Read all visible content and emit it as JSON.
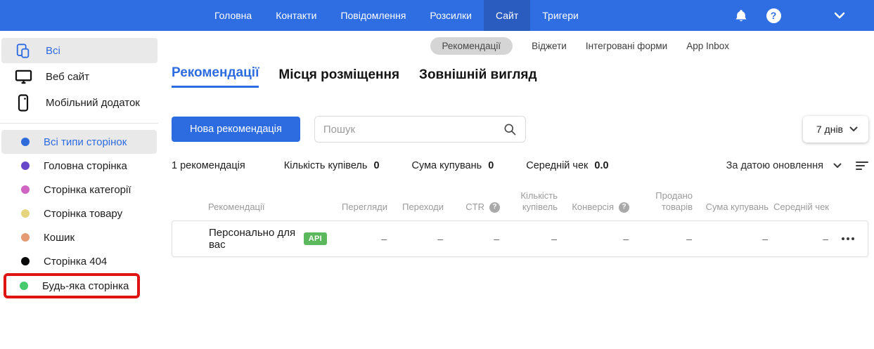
{
  "topnav": {
    "items": [
      {
        "label": "Головна",
        "active": false
      },
      {
        "label": "Контакти",
        "active": false
      },
      {
        "label": "Повідомлення",
        "active": false
      },
      {
        "label": "Розсилки",
        "active": false
      },
      {
        "label": "Сайт",
        "active": true
      },
      {
        "label": "Тригери",
        "active": false
      }
    ],
    "icons": [
      "bell-icon",
      "help-icon",
      "chevron-down-icon"
    ]
  },
  "subnav": {
    "items": [
      {
        "label": "Рекомендації",
        "active": true
      },
      {
        "label": "Віджети",
        "active": false
      },
      {
        "label": "Інтегровані форми",
        "active": false
      },
      {
        "label": "App Inbox",
        "active": false
      }
    ]
  },
  "sidebar": {
    "sources": [
      {
        "label": "Всі",
        "icon": "devices-icon",
        "active": true
      },
      {
        "label": "Веб сайт",
        "icon": "desktop-icon",
        "active": false
      },
      {
        "label": "Мобільний додаток",
        "icon": "mobile-icon",
        "active": false
      }
    ],
    "page_types": [
      {
        "label": "Всі типи сторінок",
        "dot": "#2e6bd9",
        "active": true,
        "highlighted": false
      },
      {
        "label": "Головна сторінка",
        "dot": "#6847c8",
        "active": false,
        "highlighted": false
      },
      {
        "label": "Сторінка категорії",
        "dot": "#cf64c3",
        "active": false,
        "highlighted": false
      },
      {
        "label": "Сторінка товару",
        "dot": "#e6d47e",
        "active": false,
        "highlighted": false
      },
      {
        "label": "Кошик",
        "dot": "#e49a72",
        "active": false,
        "highlighted": false
      },
      {
        "label": "Сторінка 404",
        "dot": "#0a0a0a",
        "active": false,
        "highlighted": false
      },
      {
        "label": "Будь-яка сторінка",
        "dot": "#47c96e",
        "active": false,
        "highlighted": true
      }
    ]
  },
  "tabs": [
    {
      "label": "Рекомендації",
      "active": true
    },
    {
      "label": "Місця розміщення",
      "active": false
    },
    {
      "label": "Зовнішній вигляд",
      "active": false
    }
  ],
  "toolbar": {
    "new_button": "Нова рекомендація",
    "search_placeholder": "Пошук",
    "search_value": "",
    "period": "7 днів"
  },
  "stats": [
    {
      "label": "1 рекомендація",
      "value": ""
    },
    {
      "label": "Кількість купівель",
      "value": "0"
    },
    {
      "label": "Сума купувань",
      "value": "0"
    },
    {
      "label": "Середній чек",
      "value": "0.0"
    }
  ],
  "sort": {
    "label": "За датою оновлення",
    "icon": "sort-lines-icon"
  },
  "table": {
    "columns": [
      {
        "label": "Рекомендації",
        "help": false
      },
      {
        "label": "Перегляди",
        "help": false
      },
      {
        "label": "Переходи",
        "help": false
      },
      {
        "label": "CTR",
        "help": true
      },
      {
        "label": "Кількість купівель",
        "help": false
      },
      {
        "label": "Конверсія",
        "help": true
      },
      {
        "label": "Продано товарів",
        "help": false
      },
      {
        "label": "Сума купувань",
        "help": false
      },
      {
        "label": "Середній чек",
        "help": false
      }
    ],
    "rows": [
      {
        "name": "Персонально для вас",
        "badge": "API",
        "values": [
          "–",
          "–",
          "–",
          "–",
          "–",
          "–",
          "–",
          "–"
        ]
      }
    ]
  },
  "colors": {
    "accent_blue": "#2d6ce0",
    "topbar_blue": "#2e6de2",
    "active_tab_blue": "#2a5cc0",
    "badge_green": "#5cb85c",
    "highlight_red": "#e01313",
    "selected_gray": "#e9e9e9"
  }
}
